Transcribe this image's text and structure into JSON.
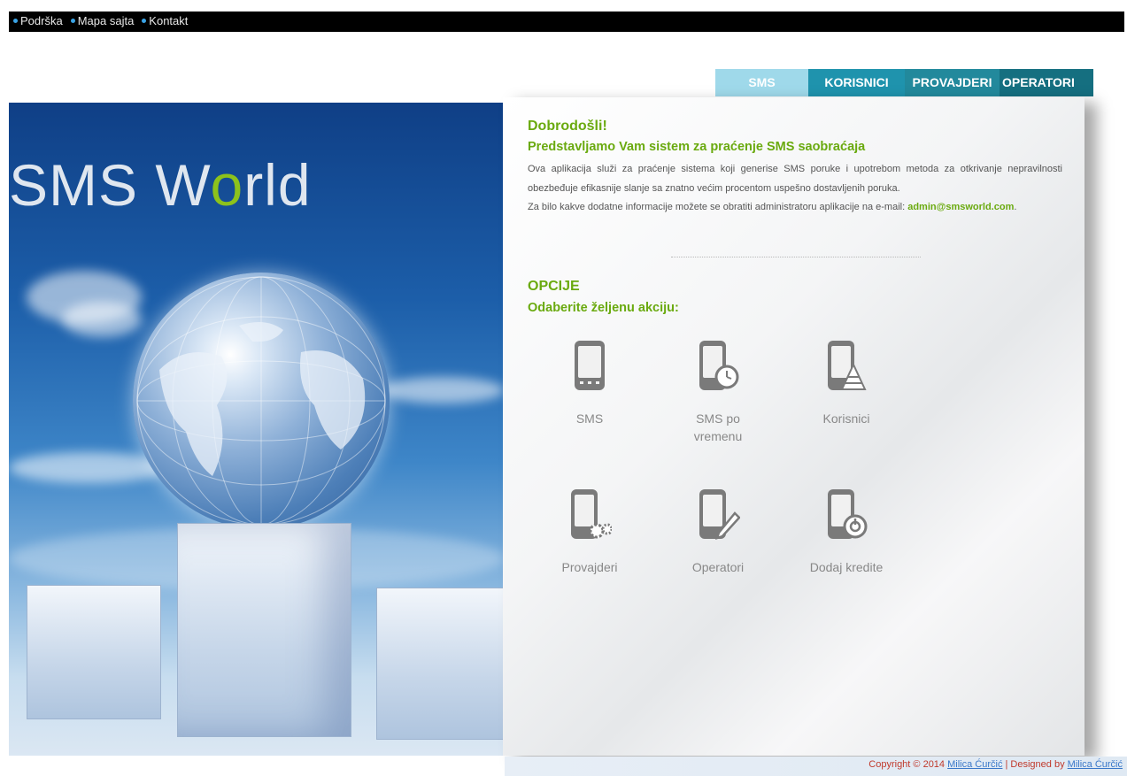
{
  "topbar": {
    "links": [
      "Podrška",
      "Mapa sajta",
      "Kontakt"
    ]
  },
  "nav": {
    "tabs": [
      "SMS",
      "KORISNICI",
      "PROVAJDERI",
      "OPERATORI"
    ]
  },
  "hero": {
    "title_before": "SMS W",
    "title_o": "o",
    "title_after": "rld"
  },
  "welcome": {
    "heading": "Dobrodošli!",
    "subheading": "Predstavljamo Vam sistem za praćenje SMS saobraćaja",
    "paragraph1": "Ova aplikacija služi za praćenje sistema koji generise SMS poruke i upotrebom metoda za otkrivanje nepravilnosti obezbeđuje efikasnije slanje sa znatno većim procentom uspešno dostavljenih poruka.",
    "paragraph2": "Za bilo kakve dodatne informacije možete se obratiti administratoru aplikacije na e-mail:",
    "email": "admin@smsworld.com",
    "period": "."
  },
  "options": {
    "heading": "OPCIJE",
    "subheading": "Odaberite željenu akciju:",
    "actions": [
      {
        "label": "SMS",
        "icon": "phone-icon"
      },
      {
        "label": "SMS po vremenu",
        "icon": "phone-clock-icon"
      },
      {
        "label": "Korisnici",
        "icon": "phone-users-icon"
      },
      {
        "label": "Provajderi",
        "icon": "phone-gears-icon"
      },
      {
        "label": "Operatori",
        "icon": "phone-pencil-icon"
      },
      {
        "label": "Dodaj kredite",
        "icon": "phone-power-icon"
      }
    ]
  },
  "footer": {
    "copyright": "Copyright © 2014",
    "author1": "Milica Ćurčić",
    "designed_by": "| Designed by",
    "author2": "Milica Ćurčić"
  },
  "colors": {
    "accent_green": "#6aaa0f",
    "topbar_bg": "#000000",
    "dot_blue": "#3aa4e6"
  }
}
